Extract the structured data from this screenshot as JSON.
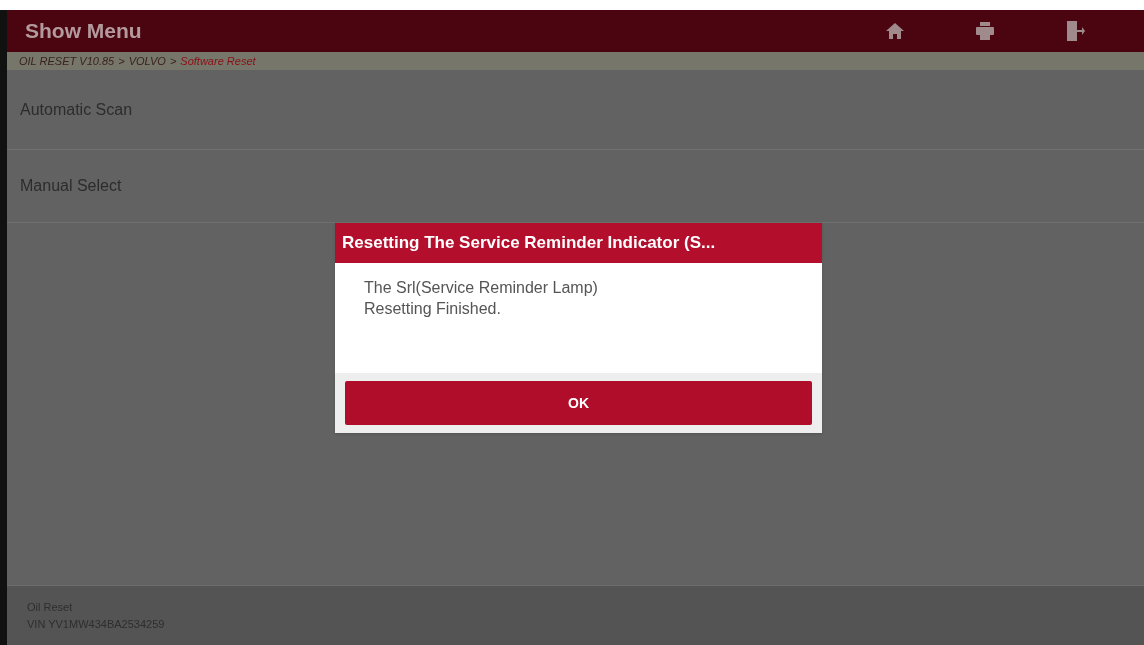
{
  "header": {
    "title": "Show Menu"
  },
  "breadcrumb": [
    {
      "kind": "crumb",
      "text": "OIL RESET V10.85",
      "selected": false
    },
    {
      "kind": "separator",
      "text": ">"
    },
    {
      "kind": "crumb",
      "text": "VOLVO",
      "selected": false
    },
    {
      "kind": "separator",
      "text": ">"
    },
    {
      "kind": "crumb",
      "text": "Software Reset",
      "selected": true
    }
  ],
  "menu": [
    {
      "label": "Automatic Scan"
    },
    {
      "label": "Manual Select"
    }
  ],
  "dialog": {
    "title": "Resetting The Service Reminder Indicator (S...",
    "message": "The Srl(Service Reminder Lamp) Resetting Finished.",
    "button": "OK"
  },
  "footer": {
    "lines": [
      "Oil Reset",
      "VIN YV1MW434BA2534259"
    ]
  }
}
